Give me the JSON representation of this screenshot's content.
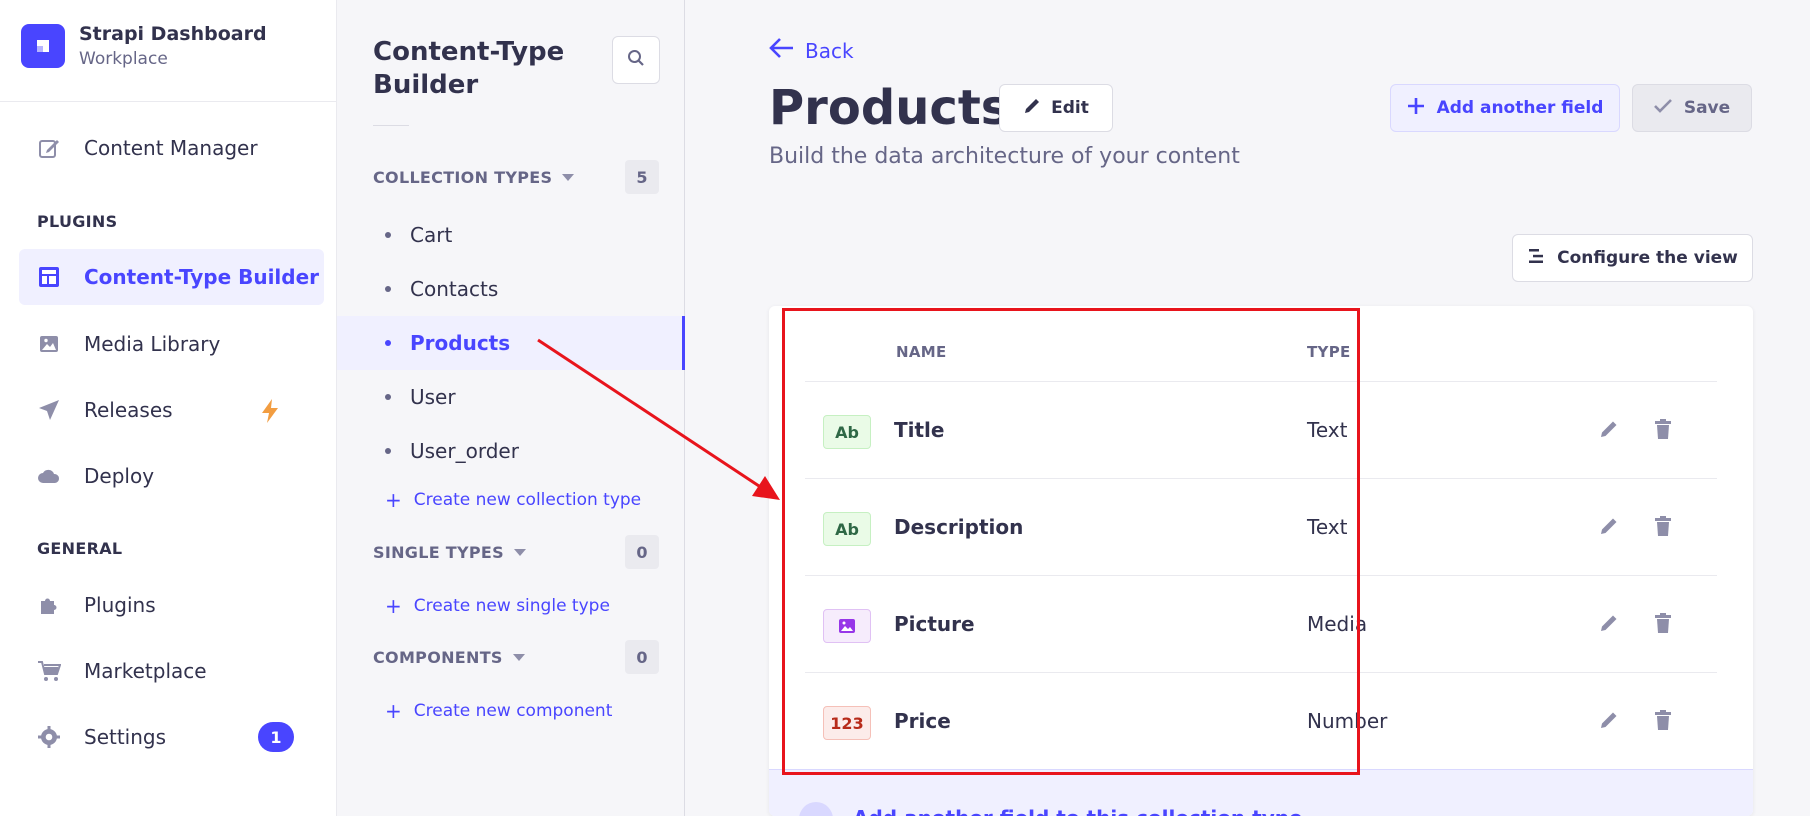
{
  "brand": {
    "title": "Strapi Dashboard",
    "subtitle": "Workplace"
  },
  "nav": {
    "content_manager": "Content Manager",
    "plugins_section": "PLUGINS",
    "ctb": "Content-Type Builder",
    "media": "Media Library",
    "releases": "Releases",
    "deploy": "Deploy",
    "general_section": "GENERAL",
    "plugins": "Plugins",
    "marketplace": "Marketplace",
    "settings": "Settings",
    "settings_badge": "1"
  },
  "subnav": {
    "title": "Content-Type Builder",
    "collection_label": "COLLECTION TYPES",
    "collection_count": "5",
    "collection_items": [
      "Cart",
      "Contacts",
      "Products",
      "User",
      "User_order"
    ],
    "active_item": "Products",
    "create_collection": "Create new collection type",
    "single_label": "SINGLE TYPES",
    "single_count": "0",
    "create_single": "Create new single type",
    "components_label": "COMPONENTS",
    "components_count": "0",
    "create_component": "Create new component"
  },
  "content": {
    "back": "Back",
    "title": "Products",
    "edit": "Edit",
    "subtitle": "Build the data architecture of your content",
    "add_field": "Add another field",
    "save": "Save",
    "configure": "Configure the view",
    "col_name": "NAME",
    "col_type": "TYPE",
    "fields": [
      {
        "icon": "Ab",
        "icon_kind": "text",
        "name": "Title",
        "type": "Text"
      },
      {
        "icon": "Ab",
        "icon_kind": "text",
        "name": "Description",
        "type": "Text"
      },
      {
        "icon": "media-icon",
        "icon_kind": "media",
        "name": "Picture",
        "type": "Media"
      },
      {
        "icon": "123",
        "icon_kind": "number",
        "name": "Price",
        "type": "Number"
      }
    ],
    "add_row": "Add another field to this collection type"
  },
  "colors": {
    "primary": "#4945ff",
    "annotation": "#e8141c",
    "bolt": "#f29d41"
  }
}
